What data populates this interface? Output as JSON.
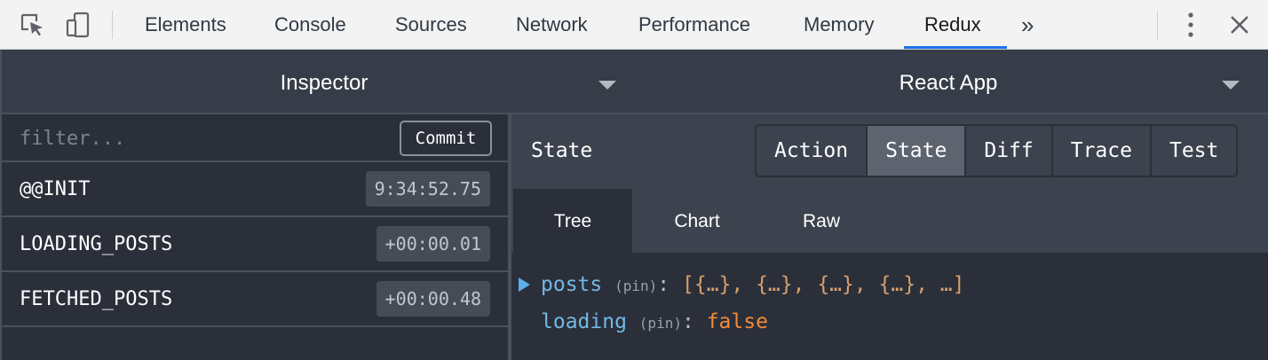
{
  "devtools": {
    "tabs": [
      "Elements",
      "Console",
      "Sources",
      "Network",
      "Performance",
      "Memory",
      "Redux"
    ],
    "active_tab": "Redux",
    "icons": [
      "inspect-element-icon",
      "device-toolbar-icon",
      "more-tabs-icon",
      "kebab-menu-icon",
      "close-icon"
    ],
    "more_tabs_label": "»",
    "accent_color": "#1a73e8"
  },
  "header": {
    "left_select": "Inspector",
    "right_select": "React App"
  },
  "actions": {
    "filter_placeholder": "filter...",
    "commit_label": "Commit",
    "items": [
      {
        "name": "@@INIT",
        "time": "9:34:52.75"
      },
      {
        "name": "LOADING_POSTS",
        "time": "+00:00.01"
      },
      {
        "name": "FETCHED_POSTS",
        "time": "+00:00.48"
      }
    ]
  },
  "monitor": {
    "title": "State",
    "buttons": [
      "Action",
      "State",
      "Diff",
      "Trace",
      "Test"
    ],
    "active_button": "State",
    "tabs": [
      "Tree",
      "Chart",
      "Raw"
    ],
    "active_tab": "Tree"
  },
  "tree": {
    "rows": [
      {
        "key": "posts",
        "pin": "(pin)",
        "colon": ":",
        "value": "[{…}, {…}, {…}, {…}, …]",
        "expandable": true
      },
      {
        "key": "loading",
        "pin": "(pin)",
        "colon": ":",
        "value": "false",
        "expandable": false
      }
    ]
  }
}
